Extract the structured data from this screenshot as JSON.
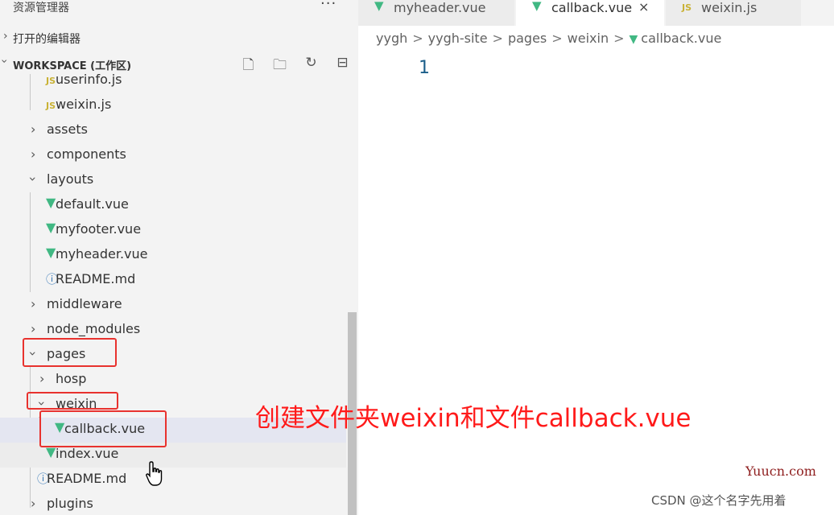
{
  "explorer": {
    "title": "资源管理器",
    "more": "···",
    "open_editors_label": "打开的编辑器",
    "workspace_label": "WORKSPACE (工作区)",
    "actions": [
      "new-file-icon",
      "new-folder-icon",
      "refresh-icon",
      "collapse-all-icon"
    ]
  },
  "tree": {
    "rows": [
      {
        "label": "userinfo.js",
        "kind": "js"
      },
      {
        "label": "weixin.js",
        "kind": "js"
      },
      {
        "label": "assets",
        "kind": "folder"
      },
      {
        "label": "components",
        "kind": "folder"
      },
      {
        "label": "layouts",
        "kind": "folder-open"
      },
      {
        "label": "default.vue",
        "kind": "vue"
      },
      {
        "label": "myfooter.vue",
        "kind": "vue"
      },
      {
        "label": "myheader.vue",
        "kind": "vue"
      },
      {
        "label": "README.md",
        "kind": "info"
      },
      {
        "label": "middleware",
        "kind": "folder"
      },
      {
        "label": "node_modules",
        "kind": "folder"
      },
      {
        "label": "pages",
        "kind": "folder-open"
      },
      {
        "label": "hosp",
        "kind": "folder"
      },
      {
        "label": "weixin",
        "kind": "folder-open"
      },
      {
        "label": "callback.vue",
        "kind": "vue"
      },
      {
        "label": "index.vue",
        "kind": "vue"
      },
      {
        "label": "README.md",
        "kind": "info"
      },
      {
        "label": "plugins",
        "kind": "folder"
      }
    ],
    "js_badge": "JS"
  },
  "tabs": [
    {
      "label": "myheader.vue",
      "kind": "vue"
    },
    {
      "label": "callback.vue",
      "kind": "vue",
      "close": "×"
    },
    {
      "label": "weixin.js",
      "kind": "js"
    }
  ],
  "breadcrumb": [
    "yygh",
    "yygh-site",
    "pages",
    "weixin",
    "callback.vue"
  ],
  "breadcrumb_sep": ">",
  "editor": {
    "line_numbers": [
      "1"
    ]
  },
  "annotation": "创建文件夹weixin和文件callback.vue",
  "watermarks": {
    "site": "Yuucn.com",
    "csdn": "CSDN @这个名字先用着"
  },
  "colors": {
    "vue": "#41b883",
    "js": "#c9b235",
    "annotation": "#ff1a1a",
    "highlight_box": "#e8322e"
  }
}
